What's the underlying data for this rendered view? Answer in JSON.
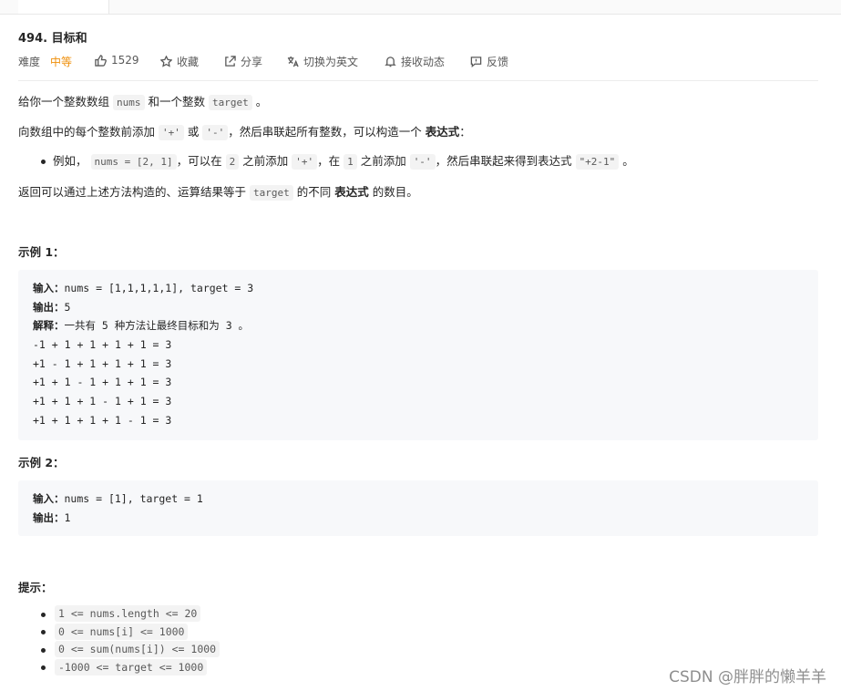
{
  "problem": {
    "title": "494. 目标和",
    "difficulty_label": "难度",
    "difficulty_value": "中等",
    "likes": "1529",
    "favorite": "收藏",
    "share": "分享",
    "switch_lang": "切换为英文",
    "notify": "接收动态",
    "feedback": "反馈"
  },
  "description": {
    "p1_a": "给你一个整数数组",
    "p1_code1": "nums",
    "p1_b": "和一个整数",
    "p1_code2": "target",
    "p1_c": "。",
    "p2_a": "向数组中的每个整数前添加",
    "p2_code1": "'+'",
    "p2_b": "或",
    "p2_code2": "'-'",
    "p2_c": "，然后串联起所有整数，可以构造一个",
    "p2_bold": "表达式",
    "p2_d": "：",
    "bullet_a": "例如，",
    "bullet_code1": "nums = [2, 1]",
    "bullet_b": "，可以在",
    "bullet_code2": "2",
    "bullet_c": "之前添加",
    "bullet_code3": "'+'",
    "bullet_d": "，在",
    "bullet_code4": "1",
    "bullet_e": "之前添加",
    "bullet_code5": "'-'",
    "bullet_f": "，然后串联起来得到表达式",
    "bullet_code6": "\"+2-1\"",
    "bullet_g": "。",
    "p3_a": "返回可以通过上述方法构造的、运算结果等于",
    "p3_code": "target",
    "p3_b": "的不同",
    "p3_bold": "表达式",
    "p3_c": "的数目。"
  },
  "example1": {
    "heading": "示例 1：",
    "input_label": "输入：",
    "input_value": "nums = [1,1,1,1,1], target = 3",
    "output_label": "输出：",
    "output_value": "5",
    "explain_label": "解释：",
    "explain_value": "一共有 5 种方法让最终目标和为 3 。",
    "lines": [
      "-1 + 1 + 1 + 1 + 1 = 3",
      "+1 - 1 + 1 + 1 + 1 = 3",
      "+1 + 1 - 1 + 1 + 1 = 3",
      "+1 + 1 + 1 - 1 + 1 = 3",
      "+1 + 1 + 1 + 1 - 1 = 3"
    ]
  },
  "example2": {
    "heading": "示例 2：",
    "input_label": "输入：",
    "input_value": "nums = [1], target = 1",
    "output_label": "输出：",
    "output_value": "1"
  },
  "constraints": {
    "heading": "提示：",
    "items": [
      "1 <= nums.length <= 20",
      "0 <= nums[i] <= 1000",
      "0 <= sum(nums[i]) <= 1000",
      "-1000 <= target <= 1000"
    ]
  },
  "watermark": "CSDN @胖胖的懒羊羊",
  "colors": {
    "difficulty_medium": "#ef8f0b",
    "code_bg": "#f3f3f3",
    "pre_bg": "#f7f8fa"
  },
  "icons": {
    "like": "thumbs-up-icon",
    "favorite": "star-icon",
    "share": "share-icon",
    "lang": "translate-icon",
    "notify": "bell-icon",
    "feedback": "feedback-icon"
  }
}
